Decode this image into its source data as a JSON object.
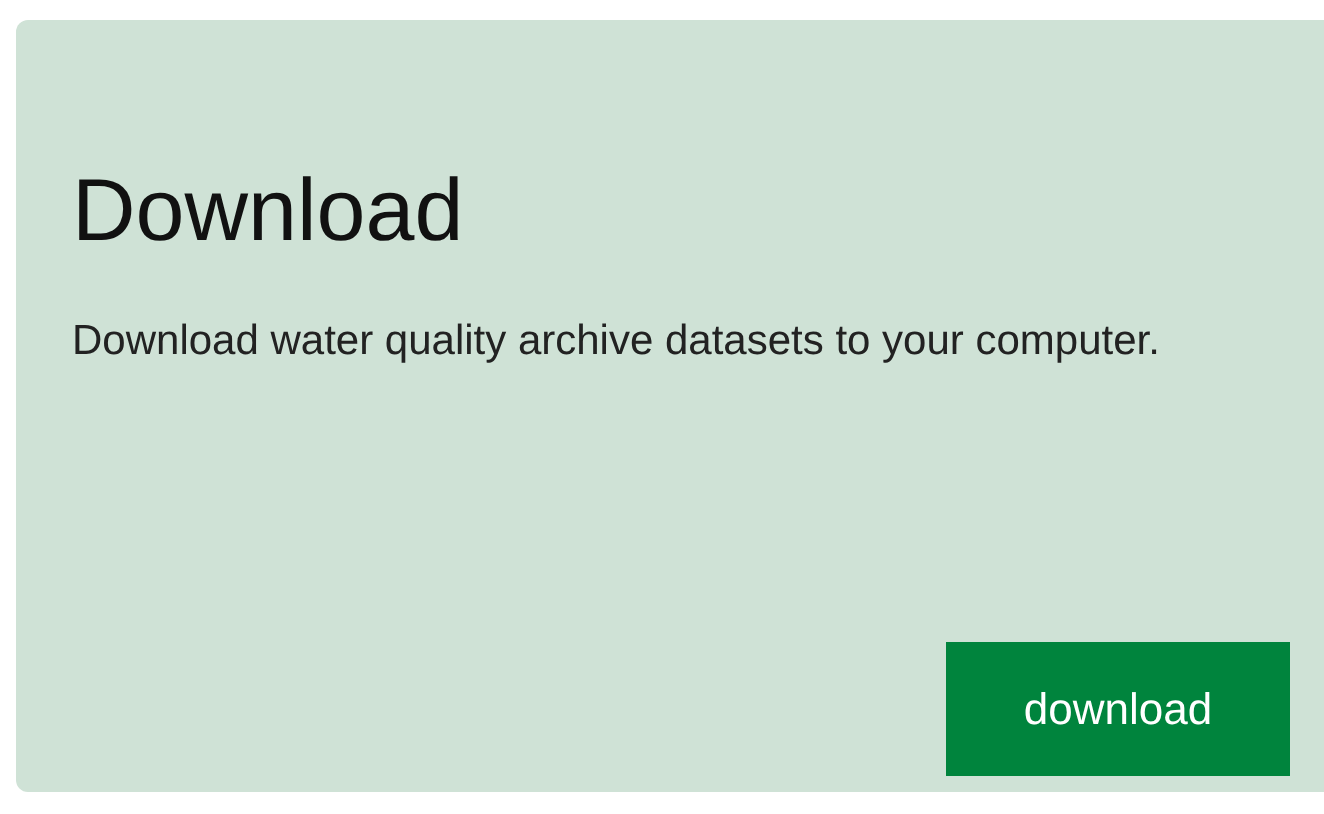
{
  "card": {
    "title": "Download",
    "description": "Download water quality archive datasets to your computer.",
    "button": "download"
  }
}
